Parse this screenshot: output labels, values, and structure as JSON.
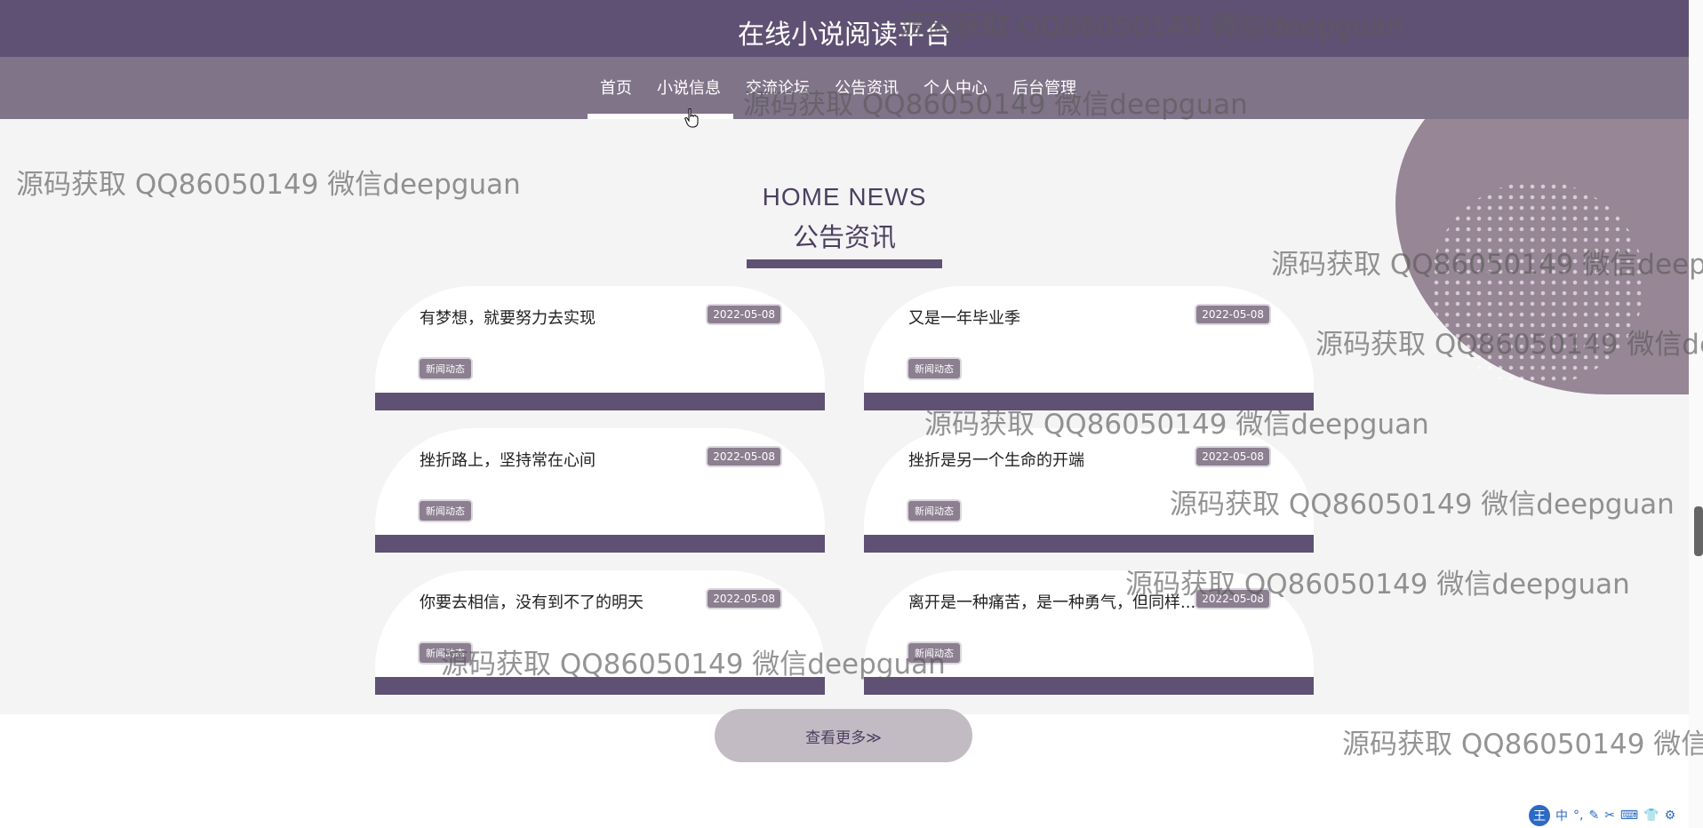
{
  "site": {
    "title": "在线小说阅读平台"
  },
  "nav": {
    "items": [
      {
        "label": "首页"
      },
      {
        "label": "小说信息"
      },
      {
        "label": "交流论坛"
      },
      {
        "label": "公告资讯"
      },
      {
        "label": "个人中心"
      },
      {
        "label": "后台管理"
      }
    ]
  },
  "section": {
    "title_en": "HOME NEWS",
    "title_cn": "公告资讯"
  },
  "news": [
    {
      "title": "有梦想，就要努力去实现",
      "date": "2022-05-08",
      "tag": "新闻动态"
    },
    {
      "title": "又是一年毕业季",
      "date": "2022-05-08",
      "tag": "新闻动态"
    },
    {
      "title": "挫折路上，坚持常在心间",
      "date": "2022-05-08",
      "tag": "新闻动态"
    },
    {
      "title": "挫折是另一个生命的开端",
      "date": "2022-05-08",
      "tag": "新闻动态"
    },
    {
      "title": "你要去相信，没有到不了的明天",
      "date": "2022-05-08",
      "tag": "新闻动态"
    },
    {
      "title": "离开是一种痛苦，是一种勇气，但同样...",
      "date": "2022-05-08",
      "tag": "新闻动态"
    }
  ],
  "more_button": {
    "label": "查看更多≫"
  },
  "watermark": {
    "text": "源码获取 QQ86050149 微信deepguan"
  },
  "ime_toolbar": {
    "logo": "王",
    "lang": "中"
  },
  "colors": {
    "primary": "#5f5173",
    "nav_bg": "#807489",
    "accent": "#8b7f90"
  }
}
